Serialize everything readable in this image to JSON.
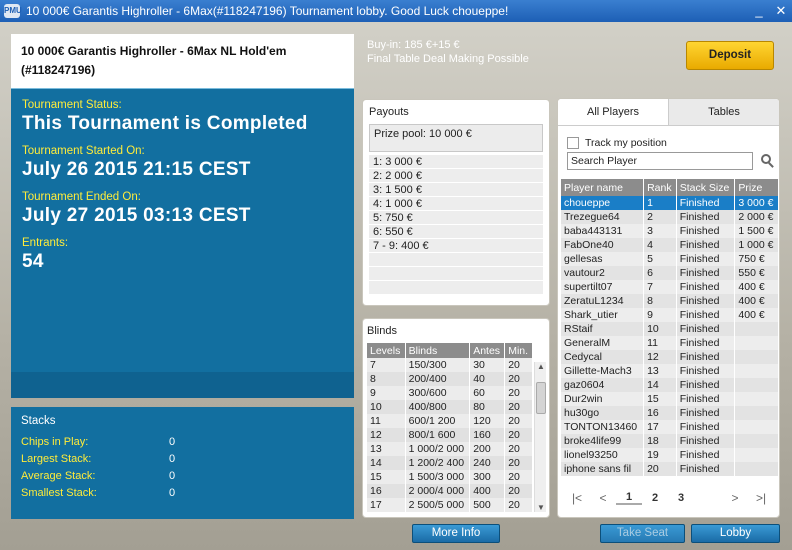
{
  "window": {
    "title": "10 000€ Garantis Highroller - 6Max(#118247196) Tournament lobby. Good Luck choueppe!",
    "app_icon": "PMU",
    "minimize": "_",
    "close": "✕"
  },
  "tournament": {
    "name_line1": "10 000€ Garantis Highroller - 6Max NL Hold'em",
    "name_line2": "(#118247196)",
    "status_label": "Tournament Status:",
    "status_value": "This Tournament is Completed",
    "started_label": "Tournament Started On:",
    "started_value": "July 26 2015  21:15 CEST",
    "ended_label": "Tournament Ended On:",
    "ended_value": "July 27 2015  03:13 CEST",
    "entrants_label": "Entrants:",
    "entrants_value": "54"
  },
  "stacks": {
    "title": "Stacks",
    "rows": [
      {
        "label": "Chips in Play:",
        "value": "0"
      },
      {
        "label": "Largest Stack:",
        "value": "0"
      },
      {
        "label": "Average Stack:",
        "value": "0"
      },
      {
        "label": "Smallest Stack:",
        "value": "0"
      }
    ]
  },
  "buyin": {
    "line1": "Buy-in: 185 €+15 €",
    "line2": "Final Table Deal Making Possible"
  },
  "deposit_label": "Deposit",
  "payouts": {
    "title": "Payouts",
    "prize_pool": "Prize pool: 10 000 €",
    "items": [
      "1: 3 000 €",
      "2: 2 000 €",
      "3: 1 500 €",
      "4: 1 000 €",
      "5: 750 €",
      "6: 550 €",
      "7 - 9: 400 €"
    ]
  },
  "blinds": {
    "title": "Blinds",
    "headers": [
      "Levels",
      "Blinds",
      "Antes",
      "Min."
    ],
    "rows": [
      [
        "7",
        "150/300",
        "30",
        "20"
      ],
      [
        "8",
        "200/400",
        "40",
        "20"
      ],
      [
        "9",
        "300/600",
        "60",
        "20"
      ],
      [
        "10",
        "400/800",
        "80",
        "20"
      ],
      [
        "11",
        "600/1 200",
        "120",
        "20"
      ],
      [
        "12",
        "800/1 600",
        "160",
        "20"
      ],
      [
        "13",
        "1 000/2 000",
        "200",
        "20"
      ],
      [
        "14",
        "1 200/2 400",
        "240",
        "20"
      ],
      [
        "15",
        "1 500/3 000",
        "300",
        "20"
      ],
      [
        "16",
        "2 000/4 000",
        "400",
        "20"
      ],
      [
        "17",
        "2 500/5 000",
        "500",
        "20"
      ]
    ]
  },
  "players": {
    "tabs": [
      "All Players",
      "Tables"
    ],
    "track_label": "Track my position",
    "search_placeholder": "Search Player",
    "headers": [
      "Player name",
      "Rank",
      "Stack Size",
      "Prize"
    ],
    "rows": [
      [
        "choueppe",
        "1",
        "Finished",
        "3 000 €"
      ],
      [
        "Trezegue64",
        "2",
        "Finished",
        "2 000 €"
      ],
      [
        "baba443131",
        "3",
        "Finished",
        "1 500 €"
      ],
      [
        "FabOne40",
        "4",
        "Finished",
        "1 000 €"
      ],
      [
        "gellesas",
        "5",
        "Finished",
        "750 €"
      ],
      [
        "vautour2",
        "6",
        "Finished",
        "550 €"
      ],
      [
        "supertilt07",
        "7",
        "Finished",
        "400 €"
      ],
      [
        "ZeratuL1234",
        "8",
        "Finished",
        "400 €"
      ],
      [
        "Shark_utier",
        "9",
        "Finished",
        "400 €"
      ],
      [
        "RStaif",
        "10",
        "Finished",
        ""
      ],
      [
        "GeneralM",
        "11",
        "Finished",
        ""
      ],
      [
        "Cedycal",
        "12",
        "Finished",
        ""
      ],
      [
        "Gillette-Mach3",
        "13",
        "Finished",
        ""
      ],
      [
        "gaz0604",
        "14",
        "Finished",
        ""
      ],
      [
        "Dur2win",
        "15",
        "Finished",
        ""
      ],
      [
        "hu30go",
        "16",
        "Finished",
        ""
      ],
      [
        "TONTON13460",
        "17",
        "Finished",
        ""
      ],
      [
        "broke4life99",
        "18",
        "Finished",
        ""
      ],
      [
        "lionel93250",
        "19",
        "Finished",
        ""
      ],
      [
        "iphone sans fil",
        "20",
        "Finished",
        ""
      ]
    ],
    "pages": [
      "1",
      "2",
      "3"
    ],
    "pager_first": "|<",
    "pager_prev": "<",
    "pager_next": ">",
    "pager_last": ">|"
  },
  "buttons": {
    "more_info": "More Info",
    "take_seat": "Take Seat",
    "lobby": "Lobby"
  }
}
